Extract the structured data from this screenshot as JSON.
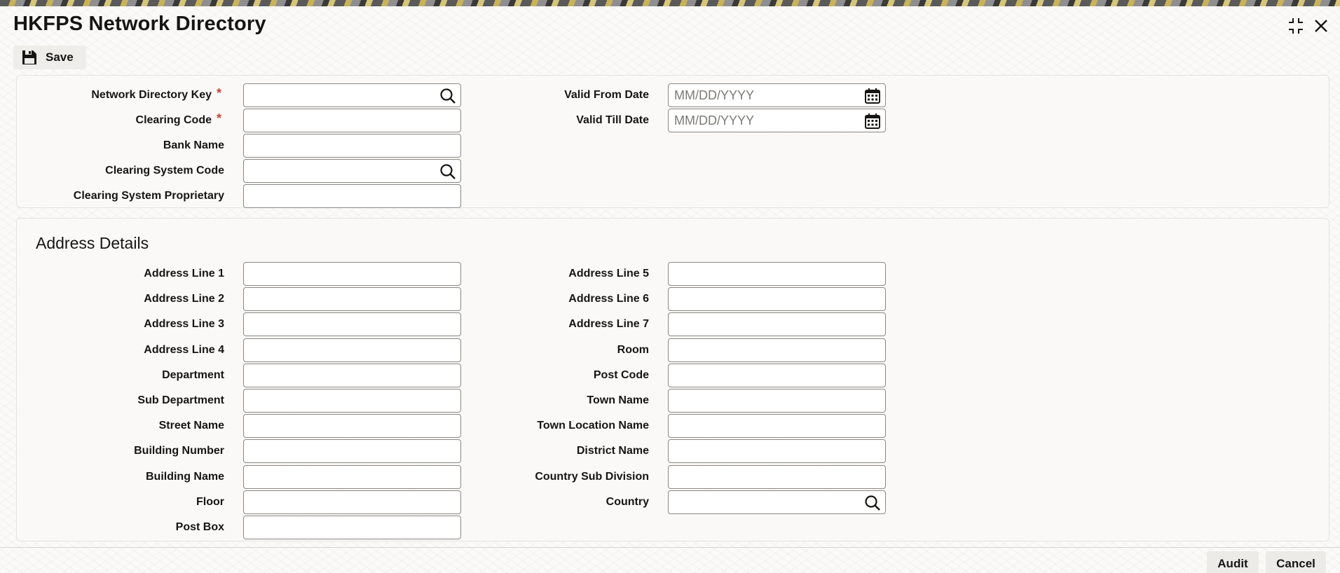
{
  "window": {
    "title": "HKFPS Network Directory",
    "minimize_icon": "collapse-icon",
    "close_icon": "close-icon"
  },
  "toolbar": {
    "save_label": "Save",
    "save_icon": "floppy-disk-icon"
  },
  "colors": {
    "required_marker": "#c74634",
    "field_border": "#8b8884",
    "panel_bg": "#faf9f7"
  },
  "main": {
    "fields_left": [
      {
        "label": "Network Directory Key",
        "required": "*",
        "value": "",
        "lookup": true
      },
      {
        "label": "Clearing Code",
        "required": "*",
        "value": ""
      },
      {
        "label": "Bank Name",
        "value": ""
      },
      {
        "label": "Clearing System Code",
        "value": "",
        "lookup": true
      },
      {
        "label": "Clearing System Proprietary",
        "value": ""
      }
    ],
    "fields_right": [
      {
        "label": "Valid From Date",
        "value": "",
        "placeholder": "MM/DD/YYYY",
        "calendar": true
      },
      {
        "label": "Valid Till Date",
        "value": "",
        "placeholder": "MM/DD/YYYY",
        "calendar": true
      }
    ]
  },
  "address": {
    "section_title": "Address Details",
    "left": [
      {
        "label": "Address Line 1",
        "value": ""
      },
      {
        "label": "Address Line 2",
        "value": ""
      },
      {
        "label": "Address Line 3",
        "value": ""
      },
      {
        "label": "Address Line 4",
        "value": ""
      },
      {
        "label": "Department",
        "value": ""
      },
      {
        "label": "Sub Department",
        "value": ""
      },
      {
        "label": "Street Name",
        "value": ""
      },
      {
        "label": "Building Number",
        "value": ""
      },
      {
        "label": "Building Name",
        "value": ""
      },
      {
        "label": "Floor",
        "value": ""
      },
      {
        "label": "Post Box",
        "value": ""
      }
    ],
    "right": [
      {
        "label": "Address Line 5",
        "value": ""
      },
      {
        "label": "Address Line 6",
        "value": ""
      },
      {
        "label": "Address Line 7",
        "value": ""
      },
      {
        "label": "Room",
        "value": ""
      },
      {
        "label": "Post Code",
        "value": ""
      },
      {
        "label": "Town Name",
        "value": ""
      },
      {
        "label": "Town Location Name",
        "value": ""
      },
      {
        "label": "District Name",
        "value": ""
      },
      {
        "label": "Country Sub Division",
        "value": ""
      },
      {
        "label": "Country",
        "value": "",
        "lookup": true
      }
    ]
  },
  "footer": {
    "audit_label": "Audit",
    "cancel_label": "Cancel"
  }
}
